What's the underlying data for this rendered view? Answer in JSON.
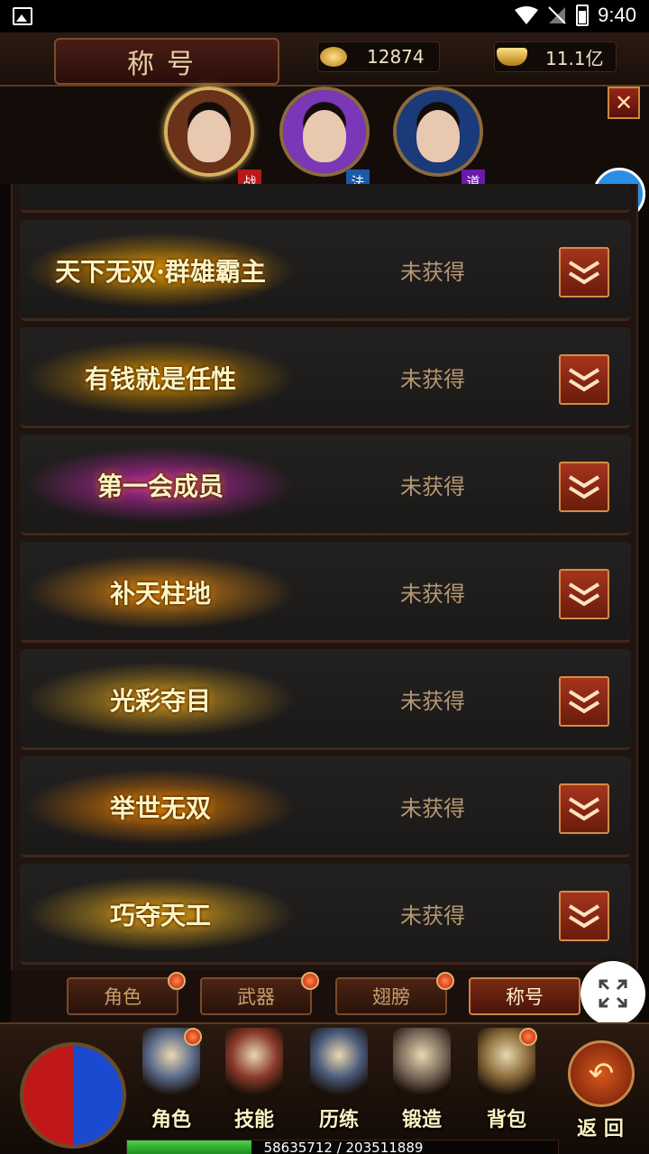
{
  "status_bar": {
    "time": "9:40"
  },
  "header": {
    "title": "称号",
    "coins": "12874",
    "ingots": "11.1亿"
  },
  "characters": [
    {
      "class_label": "战",
      "badge_color": "#b8181a",
      "hair_color": "#6a3218"
    },
    {
      "class_label": "法",
      "badge_color": "#1a5aa8",
      "hair_color": "#7a38b8"
    },
    {
      "class_label": "道",
      "badge_color": "#6a1aa8",
      "hair_color": "#1a3a7a"
    }
  ],
  "titles": [
    {
      "name": "天下无双·群雄霸主",
      "status": "未获得",
      "glow": "#ffb000"
    },
    {
      "name": "有钱就是任性",
      "status": "未获得",
      "glow": "#e6a000"
    },
    {
      "name": "第一会成员",
      "status": "未获得",
      "glow": "#e028c8"
    },
    {
      "name": "补天柱地",
      "status": "未获得",
      "glow": "#ff9a10"
    },
    {
      "name": "光彩夺目",
      "status": "未获得",
      "glow": "#e8b020"
    },
    {
      "name": "举世无双",
      "status": "未获得",
      "glow": "#ff8a00"
    },
    {
      "name": "巧夺天工",
      "status": "未获得",
      "glow": "#ffc020"
    }
  ],
  "tabs": [
    {
      "label": "角色",
      "has_dot": true
    },
    {
      "label": "武器",
      "has_dot": true
    },
    {
      "label": "翅膀",
      "has_dot": true
    },
    {
      "label": "称号",
      "has_dot": false
    }
  ],
  "nav": [
    {
      "label": "角色",
      "icon": "armor-helmet-icon",
      "color": "#5a6a8a",
      "has_dot": true
    },
    {
      "label": "技能",
      "icon": "skill-book-icon",
      "color": "#8a3a2a",
      "has_dot": false
    },
    {
      "label": "历练",
      "icon": "training-armor-icon",
      "color": "#4a5a7a",
      "has_dot": false
    },
    {
      "label": "锻造",
      "icon": "forge-hammer-icon",
      "color": "#7a6a5a",
      "has_dot": false
    },
    {
      "label": "背包",
      "icon": "backpack-chest-icon",
      "color": "#8a6a3a",
      "has_dot": true
    }
  ],
  "return_label": "返 回",
  "exp": {
    "current": "58635712",
    "max": "203511889",
    "fraction": 0.288,
    "text": "58635712 / 203511889"
  }
}
